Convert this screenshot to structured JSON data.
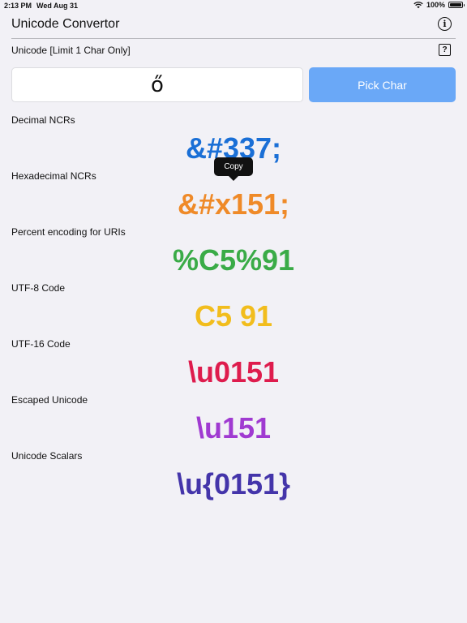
{
  "status_bar": {
    "time": "2:13 PM",
    "date": "Wed Aug 31",
    "battery": "100%"
  },
  "nav": {
    "title": "Unicode Convertor",
    "info_icon": "info-circle-icon"
  },
  "input_section": {
    "label": "Unicode [Limit 1 Char Only]",
    "help_icon": "question-square-icon",
    "char_value": "ő",
    "pick_button_label": "Pick Char"
  },
  "tooltip": {
    "label": "Copy"
  },
  "sections": [
    {
      "label": "Decimal NCRs",
      "value": "&#337;",
      "color": "#1a6fd6"
    },
    {
      "label": "Hexadecimal NCRs",
      "value": "&#x151;",
      "color": "#ef8a28"
    },
    {
      "label": "Percent encoding for URIs",
      "value": "%C5%91",
      "color": "#3aab47"
    },
    {
      "label": "UTF-8 Code",
      "value": "C5 91",
      "color": "#f2bd1d"
    },
    {
      "label": "UTF-16 Code",
      "value": "\\u0151",
      "color": "#de1c4d"
    },
    {
      "label": "Escaped Unicode",
      "value": "\\u151",
      "color": "#a03ad1"
    },
    {
      "label": "Unicode Scalars",
      "value": "\\u{0151}",
      "color": "#4435aa"
    }
  ]
}
